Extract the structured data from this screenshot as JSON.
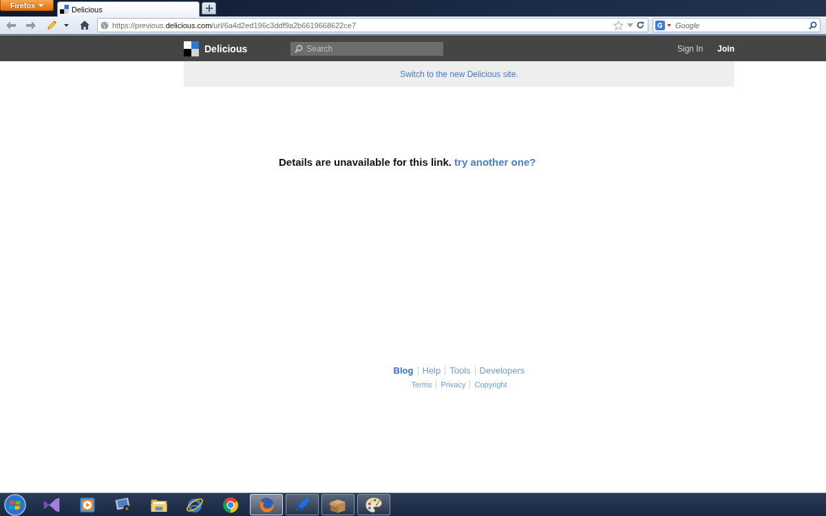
{
  "browser": {
    "menu_button": "Firefox",
    "tabs": [
      {
        "title": "Delicious",
        "selected": true
      }
    ],
    "address": "https://previous.**delicious.com**/url/6a4d2ed196c3ddf9a2b6619668622ce7",
    "search": {
      "placeholder": "Google"
    }
  },
  "site_header": {
    "brand": "Delicious",
    "search": {
      "placeholder": "Search"
    },
    "links": [
      {
        "label": "Sign In",
        "kind": "plain"
      },
      {
        "label": "Join",
        "kind": "bold"
      }
    ]
  },
  "notice": {
    "link": "Switch to the new Delicious site."
  },
  "message": {
    "text": "Details are unavailable for this link.",
    "link": "try another one?"
  },
  "footer": {
    "links": [
      {
        "label": "Blog",
        "kind": "bold"
      },
      {
        "label": "Help",
        "kind": "plain"
      },
      {
        "label": "Tools",
        "kind": "plain"
      },
      {
        "label": "Developers",
        "kind": "plain"
      }
    ],
    "legal_links": [
      {
        "label": "Terms"
      },
      {
        "label": "Privacy"
      },
      {
        "label": "Copyright"
      }
    ]
  },
  "taskbar": {
    "buttons": [
      {
        "running": false,
        "selected": false
      },
      {
        "running": false,
        "selected": false
      },
      {
        "running": false,
        "selected": false
      },
      {
        "running": false,
        "selected": false
      },
      {
        "running": false,
        "selected": false
      },
      {
        "running": false,
        "selected": false
      },
      {
        "running": true,
        "selected": true
      },
      {
        "running": true,
        "selected": false
      },
      {
        "running": true,
        "selected": false
      },
      {
        "running": true,
        "selected": false
      }
    ]
  }
}
